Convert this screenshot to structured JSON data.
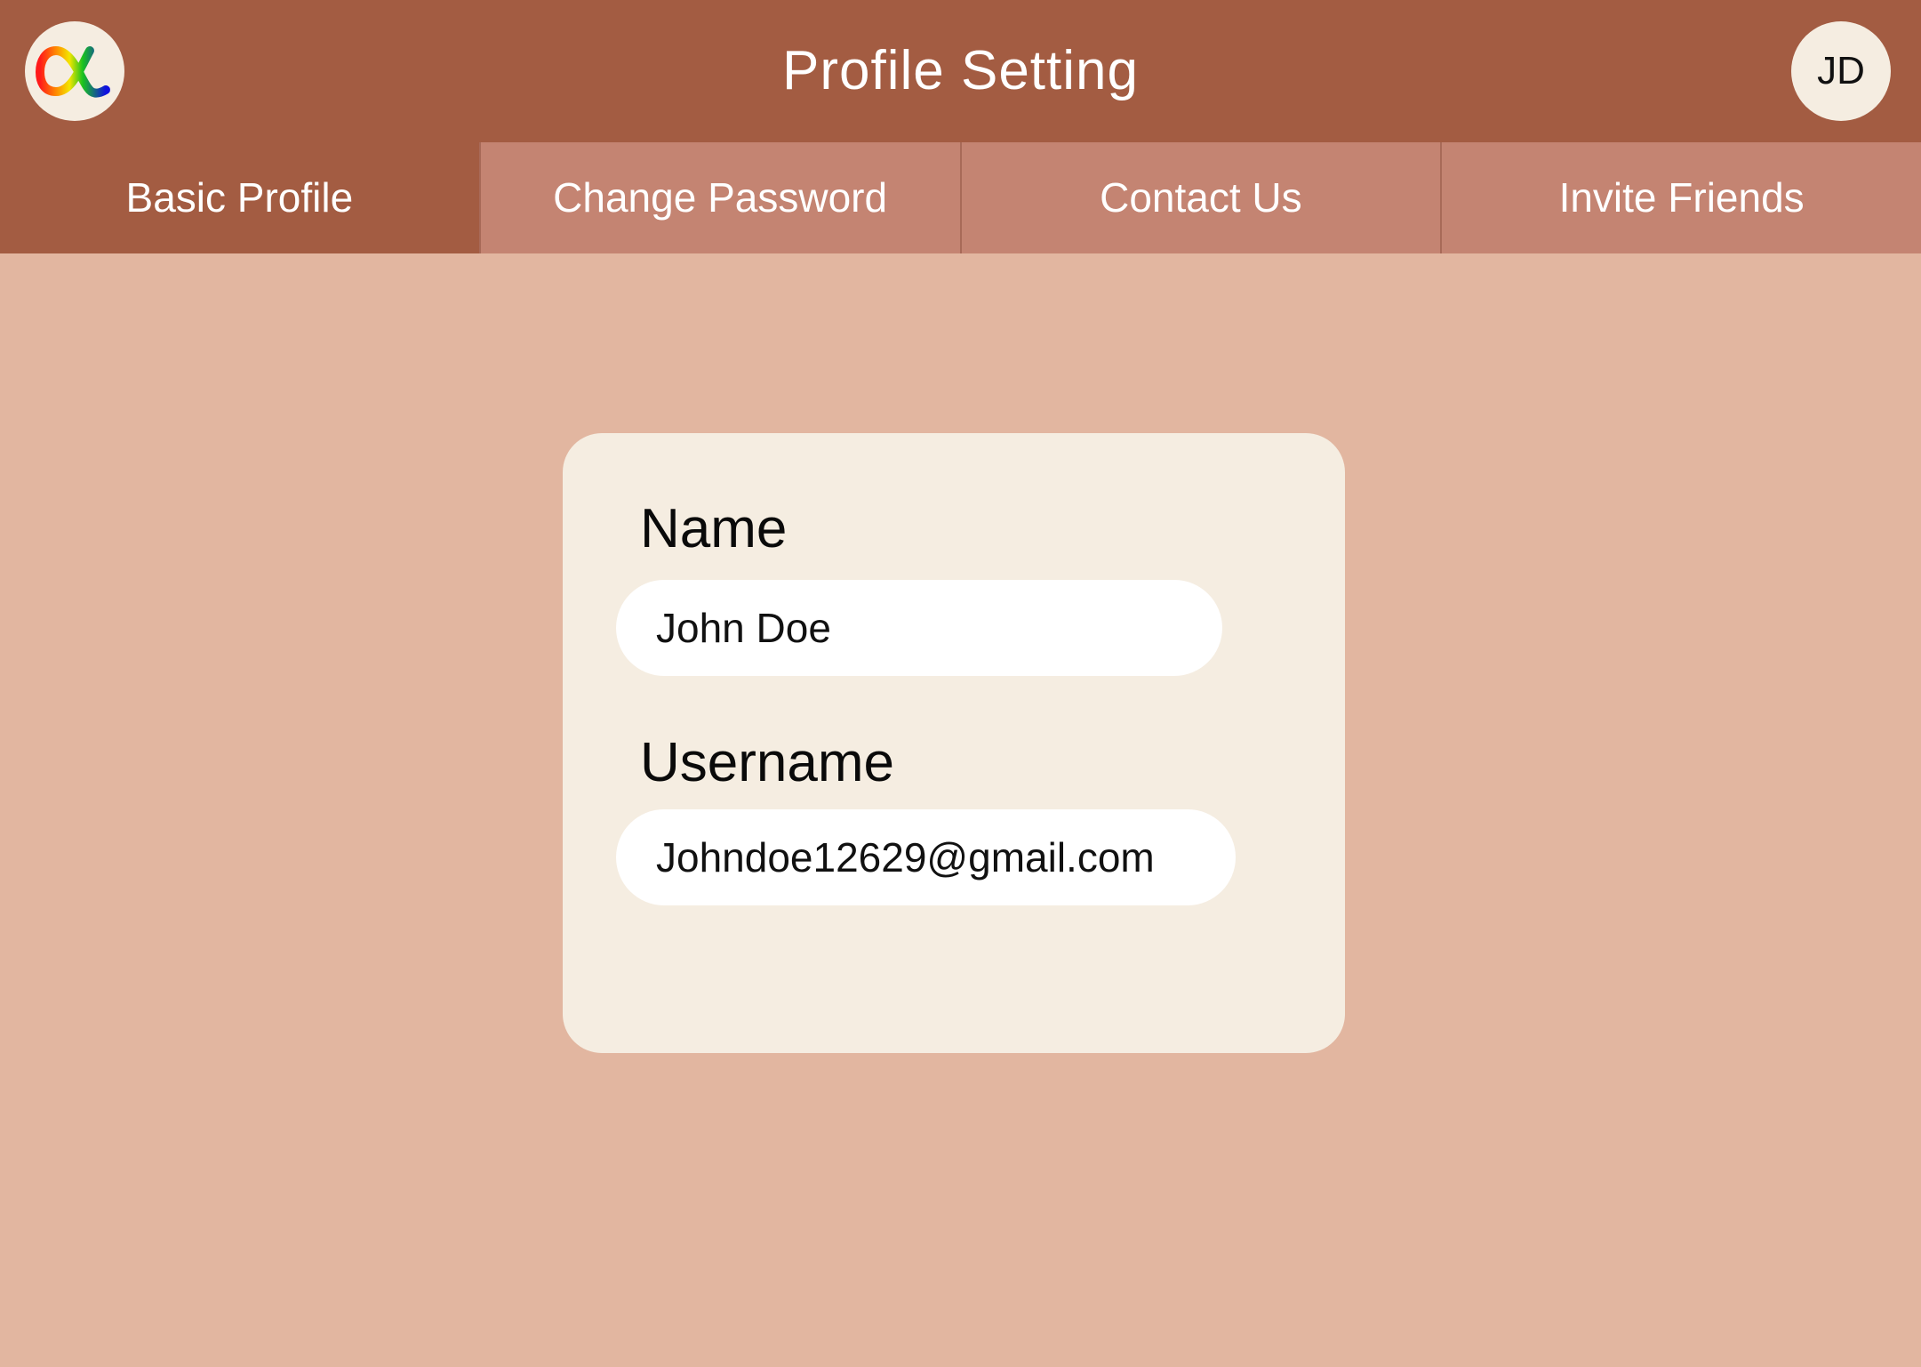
{
  "header": {
    "title": "Profile Setting",
    "avatar_initials": "JD",
    "logo_icon": "alpha-logo-icon",
    "background_color": "#A35C42"
  },
  "tabs": [
    {
      "label": "Basic Profile",
      "active": true
    },
    {
      "label": "Change Password",
      "active": false
    },
    {
      "label": "Contact Us",
      "active": false
    },
    {
      "label": "Invite Friends",
      "active": false
    }
  ],
  "form": {
    "name_label": "Name",
    "name_value": "John Doe",
    "username_label": "Username",
    "username_value": "Johndoe12629@gmail.com"
  },
  "colors": {
    "page_background": "#E2B6A0",
    "card_background": "#F5EDE1",
    "tab_inactive": "#C48472",
    "tab_active": "#A35C42"
  }
}
